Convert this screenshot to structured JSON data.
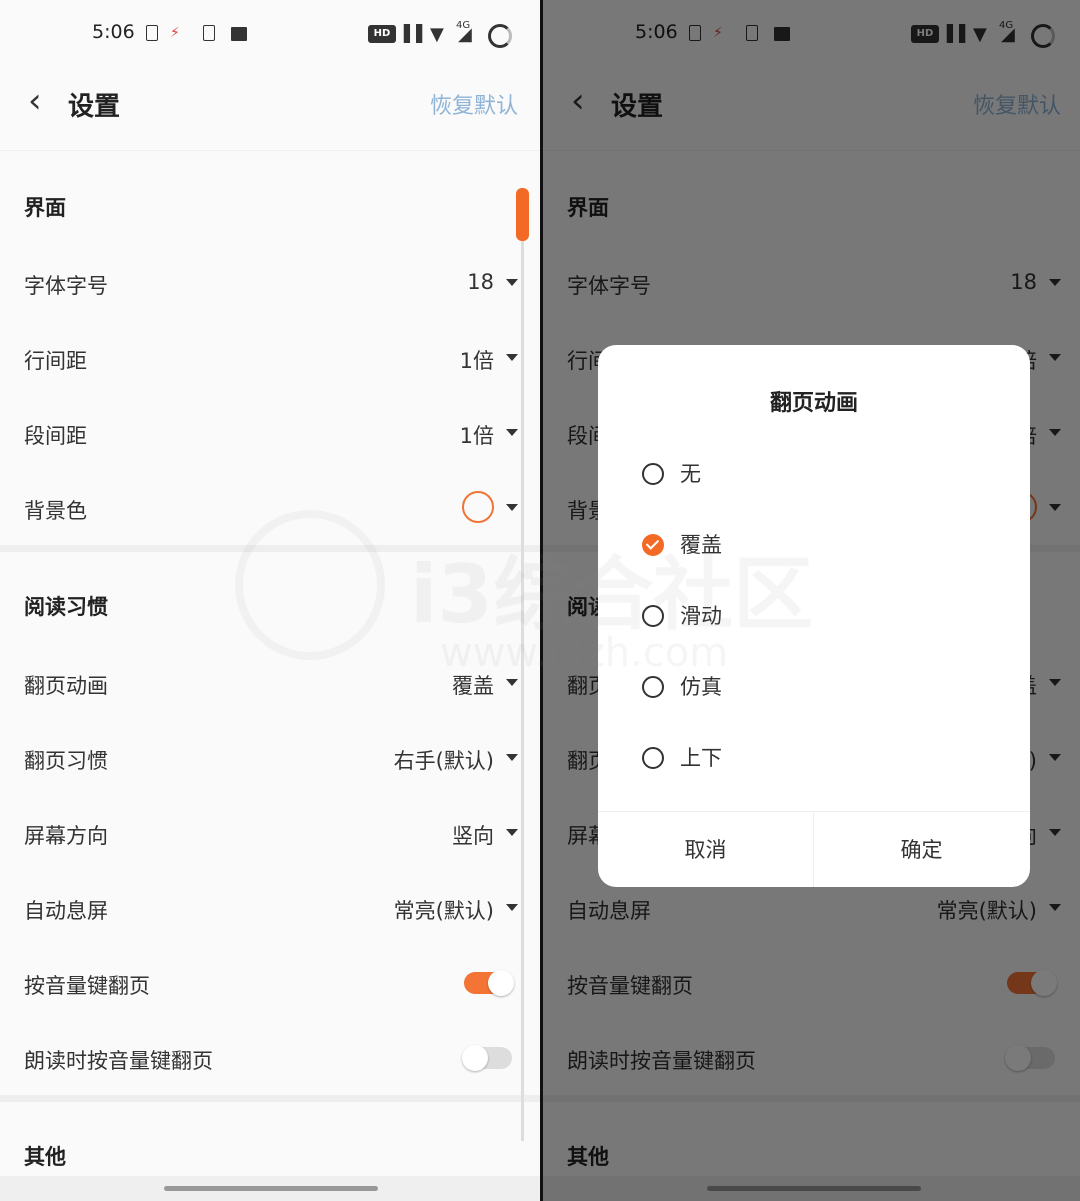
{
  "status_bar": {
    "time": "5:06",
    "hd": "HD",
    "network": "4G"
  },
  "header": {
    "back_icon": "chevron-left-icon",
    "title": "设置",
    "restore": "恢复默认"
  },
  "sections": {
    "interface": {
      "title": "界面",
      "font_size_label": "字体字号",
      "font_size_value": "18",
      "line_spacing_label": "行间距",
      "line_spacing_value": "1倍",
      "paragraph_spacing_label": "段间距",
      "paragraph_spacing_value": "1倍",
      "bg_color_label": "背景色",
      "bg_color_value": "#f07438"
    },
    "reading": {
      "title": "阅读习惯",
      "page_anim_label": "翻页动画",
      "page_anim_value": "覆盖",
      "page_habit_label": "翻页习惯",
      "page_habit_value": "右手(默认)",
      "orientation_label": "屏幕方向",
      "orientation_value": "竖向",
      "auto_screen_off_label": "自动息屏",
      "auto_screen_off_value": "常亮(默认)",
      "volume_key_label": "按音量键翻页",
      "volume_key_on": true,
      "read_aloud_volume_label": "朗读时按音量键翻页",
      "read_aloud_volume_on": false
    },
    "other": {
      "title": "其他"
    }
  },
  "dialog": {
    "title": "翻页动画",
    "options": [
      "无",
      "覆盖",
      "滑动",
      "仿真",
      "上下"
    ],
    "selected": "覆盖",
    "cancel": "取消",
    "confirm": "确定"
  },
  "colors": {
    "accent": "#f26a26",
    "restore": "#8fb4d6"
  },
  "watermark": {
    "text": "i3综合社区",
    "url": "www.i3zh.com"
  }
}
